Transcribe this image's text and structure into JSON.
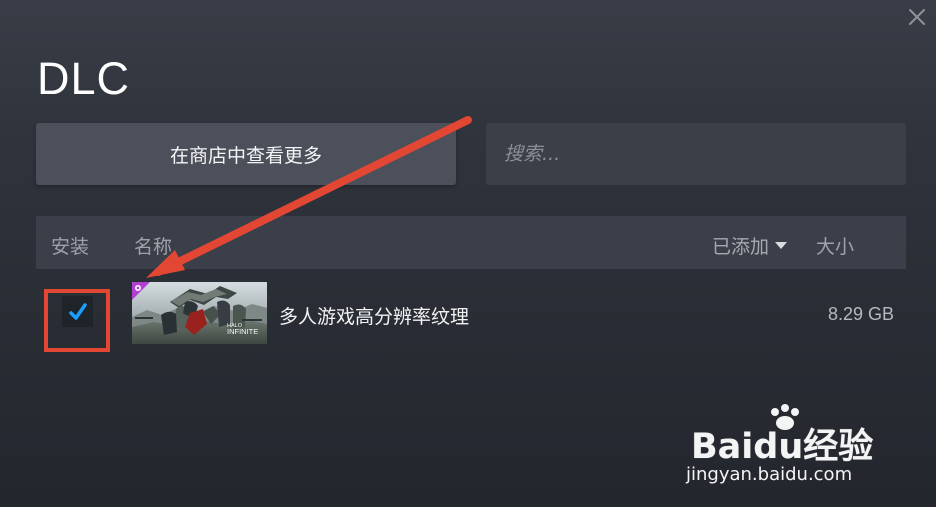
{
  "dialog": {
    "title": "DLC",
    "close_label": "×"
  },
  "toolbar": {
    "store_button_label": "在商店中查看更多",
    "search_placeholder": "搜索..."
  },
  "table": {
    "headers": {
      "install": "安装",
      "name": "名称",
      "added": "已添加",
      "size": "大小"
    },
    "rows": [
      {
        "installed": true,
        "name": "多人游戏高分辨率纹理",
        "size": "8.29 GB"
      }
    ]
  },
  "watermark": {
    "main": "Baidu经验",
    "sub": "jingyan.baidu.com"
  },
  "colors": {
    "accent_blue": "#1a9fff",
    "annotation_red": "#e24734",
    "header_bg": "#3b3f49"
  }
}
